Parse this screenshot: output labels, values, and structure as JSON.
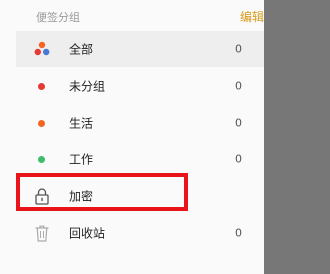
{
  "header": {
    "title": "便签分组",
    "edit_label": "编辑"
  },
  "groups": [
    {
      "label": "全部",
      "count": "0",
      "icon": "all-groups-icon"
    },
    {
      "label": "未分组",
      "count": "0",
      "color": "#e53935"
    },
    {
      "label": "生活",
      "count": "0",
      "color": "#f26522"
    },
    {
      "label": "工作",
      "count": "0",
      "color": "#3ebd6a"
    },
    {
      "label": "加密",
      "icon": "lock-icon"
    },
    {
      "label": "回收站",
      "count": "0",
      "icon": "trash-icon"
    }
  ],
  "colors": {
    "accent": "#d79b1c",
    "highlight_border": "#e8141a",
    "overlay": "#777777"
  }
}
